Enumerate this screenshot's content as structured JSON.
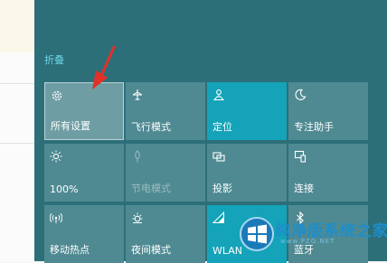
{
  "panel": {
    "collapse_label": "折叠",
    "tiles": [
      {
        "label": "所有设置",
        "icon": "gear-icon"
      },
      {
        "label": "飞行模式",
        "icon": "airplane-icon"
      },
      {
        "label": "定位",
        "icon": "location-icon"
      },
      {
        "label": "专注助手",
        "icon": "moon-icon"
      },
      {
        "label": "100%",
        "icon": "brightness-icon"
      },
      {
        "label": "节电模式",
        "icon": "battery-saver-icon"
      },
      {
        "label": "投影",
        "icon": "project-icon"
      },
      {
        "label": "连接",
        "icon": "connect-icon"
      },
      {
        "label": "移动热点",
        "icon": "hotspot-icon"
      },
      {
        "label": "夜间模式",
        "icon": "night-light-icon"
      },
      {
        "label": "WLAN",
        "icon": "wifi-icon"
      },
      {
        "label": "蓝牙",
        "icon": "bluetooth-icon"
      }
    ]
  },
  "watermark": {
    "title": "纯净版系统之家",
    "url": "www.PZG.NET"
  },
  "colors": {
    "panel_bg": "#2d6f79",
    "tile_off": "#4f8a92",
    "tile_on": "#14a3b8",
    "accent_text": "#6ed3e4",
    "arrow": "#e0312a"
  }
}
